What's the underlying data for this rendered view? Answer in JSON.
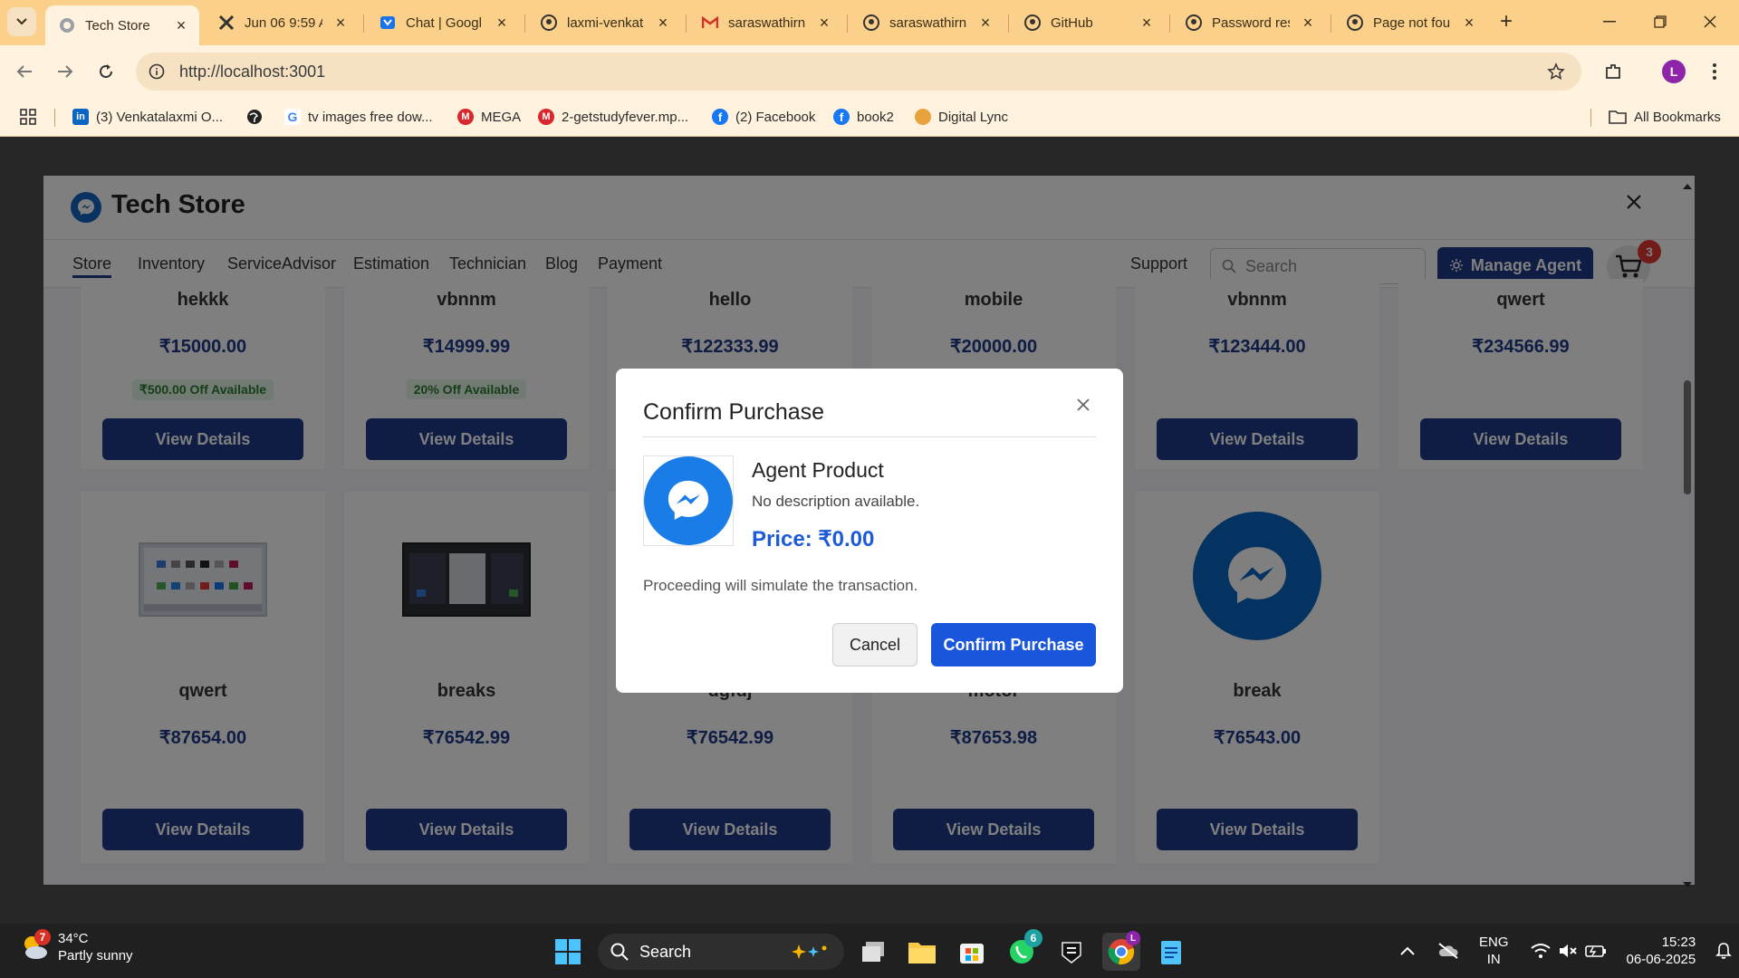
{
  "browser": {
    "tabs": [
      {
        "title": "Tech Store",
        "icon": "globe-icon",
        "active": true
      },
      {
        "title": "Jun 06 9:59 A",
        "icon": "scissors-icon"
      },
      {
        "title": "Chat | Googl",
        "icon": "chat-icon"
      },
      {
        "title": "laxmi-venkat",
        "icon": "github-icon"
      },
      {
        "title": "saraswathirn",
        "icon": "gmail-icon"
      },
      {
        "title": "saraswathirn",
        "icon": "github-icon"
      },
      {
        "title": "GitHub",
        "icon": "github-icon"
      },
      {
        "title": "Password res",
        "icon": "github-icon"
      },
      {
        "title": "Page not fou",
        "icon": "github-icon"
      }
    ],
    "url": "http://localhost:3001",
    "profile_initial": "L",
    "bookmarks": [
      {
        "label": "(3) Venkatalaxmi O...",
        "icon": "linkedin-icon",
        "color": "#0a66c2"
      },
      {
        "label": "",
        "icon": "globe-icon",
        "color": "#222222"
      },
      {
        "label": "tv images free dow...",
        "icon": "google-icon",
        "color": "#ffffff"
      },
      {
        "label": "MEGA",
        "icon": "mega-icon",
        "color": "#d9272e"
      },
      {
        "label": "2-getstudyfever.mp...",
        "icon": "mega-icon",
        "color": "#d9272e"
      },
      {
        "label": "(2) Facebook",
        "icon": "facebook-icon",
        "color": "#1877f2"
      },
      {
        "label": "book2",
        "icon": "facebook-icon",
        "color": "#1877f2"
      },
      {
        "label": "Digital Lync",
        "icon": "digital-lync-icon",
        "color": "#e8a33d"
      }
    ],
    "all_bookmarks": "All Bookmarks"
  },
  "app": {
    "title": "Tech Store",
    "nav": [
      "Store",
      "Inventory",
      "ServiceAdvisor",
      "Estimation",
      "Technician",
      "Blog",
      "Payment"
    ],
    "support": "Support",
    "search_placeholder": "Search",
    "manage_agent": "Manage Agent",
    "cart_count": "3",
    "view_details": "View Details",
    "products_row1": [
      {
        "name": "hekkk",
        "price": "₹15000.00",
        "offer": "₹500.00 Off Available"
      },
      {
        "name": "vbnnm",
        "price": "₹14999.99",
        "offer": "20% Off Available"
      },
      {
        "name": "hello",
        "price": "₹122333.99",
        "offer": ""
      },
      {
        "name": "mobile",
        "price": "₹20000.00",
        "offer": ""
      },
      {
        "name": "vbnnm",
        "price": "₹123444.00",
        "offer": ""
      },
      {
        "name": "qwert",
        "price": "₹234566.99",
        "offer": ""
      }
    ],
    "products_row2": [
      {
        "name": "qwert",
        "price": "₹87654.00",
        "thumb": "screenshot-light"
      },
      {
        "name": "breaks",
        "price": "₹76542.99",
        "thumb": "screenshot-dark"
      },
      {
        "name": "dgfdj",
        "price": "₹76542.99",
        "thumb": "none"
      },
      {
        "name": "motor",
        "price": "₹87653.98",
        "thumb": "none"
      },
      {
        "name": "break",
        "price": "₹76543.00",
        "thumb": "messenger-logo"
      }
    ],
    "accent_color": "#1e3a8a"
  },
  "modal": {
    "title": "Confirm Purchase",
    "product_name": "Agent Product",
    "description": "No description available.",
    "price": "Price: ₹0.00",
    "note": "Proceeding will simulate the transaction.",
    "cancel": "Cancel",
    "confirm": "Confirm Purchase",
    "confirm_color": "#1a56db"
  },
  "taskbar": {
    "weather_badge": "7",
    "temperature": "34°C",
    "condition": "Partly sunny",
    "search": "Search",
    "whatsapp_badge": "6",
    "lang_top": "ENG",
    "lang_bottom": "IN",
    "time": "15:23",
    "date": "06-06-2025"
  }
}
